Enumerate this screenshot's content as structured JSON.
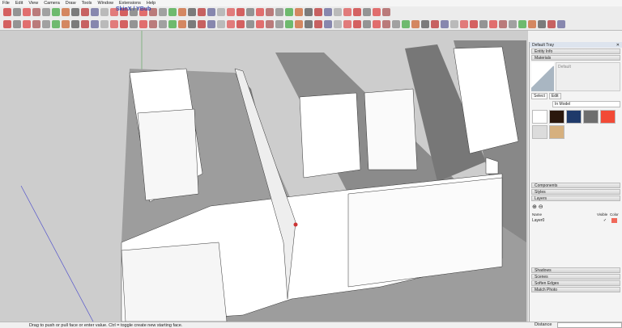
{
  "menu": [
    "File",
    "Edit",
    "View",
    "Camera",
    "Draw",
    "Tools",
    "Window",
    "Extensions",
    "Help"
  ],
  "brand": "SkinX / YBub",
  "tray": {
    "title": "Default Tray",
    "entity_info": "Entity Info",
    "materials": "Materials",
    "material_name": "Default",
    "tab_select": "Select",
    "tab_edit": "Edit",
    "collection": "In Model",
    "swatches": [
      "#ffffff",
      "#2a170c",
      "#1f3a6a",
      "#6e6e6e",
      "#f24a36",
      "#dcdcdc",
      "#d6b07e"
    ],
    "sections1": [
      "Components",
      "Styles",
      "Layers"
    ],
    "layers": {
      "col_name": "Name",
      "col_visible": "Visible",
      "col_color": "Color",
      "rows": [
        {
          "name": "Layer0",
          "visible": "✓",
          "color": "#f0695a"
        }
      ]
    },
    "sections2": [
      "Shadows",
      "Scenes",
      "Soften Edges",
      "Match Photo"
    ]
  },
  "status": {
    "message": "Drag to push or pull face or enter value.  Ctrl = toggle create new starting face.",
    "distance_label": "Distance"
  }
}
